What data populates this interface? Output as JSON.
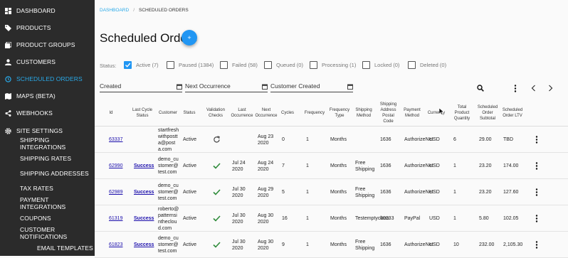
{
  "sidebar": {
    "items": [
      {
        "label": "Dashboard",
        "icon": "dashboard-icon"
      },
      {
        "label": "Products",
        "icon": "tag-icon"
      },
      {
        "label": "Product Groups",
        "icon": "product-groups-icon"
      },
      {
        "label": "Customers",
        "icon": "person-icon"
      },
      {
        "label": "Scheduled Orders",
        "icon": "scheduled-icon"
      },
      {
        "label": "Maps (beta)",
        "icon": "map-icon"
      },
      {
        "label": "Webhooks",
        "icon": "share-icon"
      },
      {
        "label": "Site Settings",
        "icon": "gear-icon"
      }
    ],
    "sub_items": [
      "Shipping Integrations",
      "Shipping Rates",
      "Shipping Addresses",
      "Tax Rates",
      "Payment Integrations",
      "Coupons",
      "Customer Notifications",
      "Email Templates"
    ],
    "active_color": "#29a9e8"
  },
  "breadcrumb": {
    "home": "Dashboard",
    "current": "Scheduled Orders"
  },
  "page": {
    "title": "Scheduled Orders",
    "add_button": "+"
  },
  "status_filter": {
    "label": "Status:",
    "options": [
      {
        "label": "Active (7)",
        "checked": true
      },
      {
        "label": "Paused (1384)",
        "checked": false
      },
      {
        "label": "Failed (58)",
        "checked": false
      },
      {
        "label": "Queued (0)",
        "checked": false
      },
      {
        "label": "Processing (1)",
        "checked": false
      },
      {
        "label": "Locked (0)",
        "checked": false
      },
      {
        "label": "Deleted (0)",
        "checked": false
      }
    ]
  },
  "date_filters": {
    "created": "Created",
    "next_occurrence": "Next Occurrence",
    "customer_created": "Customer Created"
  },
  "toolbar": {
    "search_icon": "search-icon",
    "more_icon": "more-vert-icon",
    "prev_icon": "chevron-left-icon",
    "next_icon": "chevron-right-icon"
  },
  "table": {
    "headers": [
      "Id",
      "Last Cycle Status",
      "Customer",
      "Status",
      "Validation Checks",
      "Last Occurrence",
      "Next Occurrence",
      "Cycles",
      "Frequency",
      "Frequency Type",
      "Shipping Method",
      "Shipping Address Postal Code",
      "Payment Method",
      "Currency",
      "Total Product Quantity",
      "Scheduled Order Subtotal",
      "Scheduled Order LTV"
    ],
    "rows": [
      {
        "id": "63337",
        "last_cycle": "",
        "customer": "startfreshwithpostta@posta.com",
        "status": "Active",
        "check": "refresh",
        "last_occ": "",
        "next_occ": "Aug 23 2020",
        "cycles": "0",
        "frequency": "1",
        "freq_type": "Months",
        "ship_method": "",
        "postal": "1636",
        "payment": "AuthorizeNet",
        "currency": "USD",
        "qty": "6",
        "subtotal": "29.00",
        "ltv": "TBD"
      },
      {
        "id": "62990",
        "last_cycle": "Success",
        "customer": "demo_customer@test.com",
        "status": "Active",
        "check": "ok",
        "last_occ": "Jul 24 2020",
        "next_occ": "Aug 24 2020",
        "cycles": "7",
        "frequency": "1",
        "freq_type": "Months",
        "ship_method": "Free Shipping",
        "postal": "1636",
        "payment": "AuthorizeNet",
        "currency": "USD",
        "qty": "1",
        "subtotal": "23.20",
        "ltv": "174.00"
      },
      {
        "id": "62989",
        "last_cycle": "Success",
        "customer": "demo_customer@test.com",
        "status": "Active",
        "check": "ok",
        "last_occ": "Jul 30 2020",
        "next_occ": "Aug 29 2020",
        "cycles": "5",
        "frequency": "1",
        "freq_type": "Months",
        "ship_method": "Free Shipping",
        "postal": "1636",
        "payment": "AuthorizeNet",
        "currency": "USD",
        "qty": "1",
        "subtotal": "23.20",
        "ltv": "127.60"
      },
      {
        "id": "61319",
        "last_cycle": "Success",
        "customer": "roberto@patternsinthecloud.com",
        "status": "Active",
        "check": "ok",
        "last_occ": "Jul 30 2020",
        "next_occ": "Aug 30 2020",
        "cycles": "16",
        "frequency": "1",
        "freq_type": "Months",
        "ship_method": "Testemptyclass",
        "postal": "80033",
        "payment": "PayPal",
        "currency": "USD",
        "qty": "1",
        "subtotal": "5.80",
        "ltv": "102.05"
      },
      {
        "id": "61823",
        "last_cycle": "Success",
        "customer": "demo_customer@test.com",
        "status": "Active",
        "check": "ok",
        "last_occ": "Jul 30 2020",
        "next_occ": "Aug 30 2020",
        "cycles": "9",
        "frequency": "1",
        "freq_type": "Months",
        "ship_method": "Free Shipping",
        "postal": "1636",
        "payment": "AuthorizeNet",
        "currency": "USD",
        "qty": "10",
        "subtotal": "232.00",
        "ltv": "2,105.30"
      }
    ]
  }
}
